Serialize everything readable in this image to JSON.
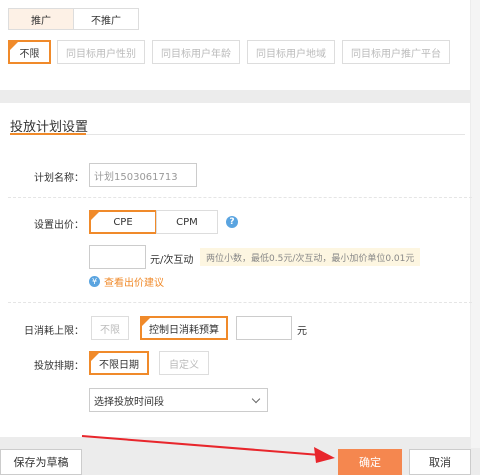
{
  "promo_tabs": [
    "推广",
    "不推广"
  ],
  "targeting": [
    "不限",
    "同目标用户性别",
    "同目标用户年龄",
    "同目标用户地域",
    "同目标用户推广平台"
  ],
  "section_title": "投放计划设置",
  "plan_name": {
    "label": "计划名称：",
    "value": "计划1503061713"
  },
  "bid": {
    "label": "设置出价：",
    "options": [
      "CPE",
      "CPM"
    ],
    "unit": "元/次互动",
    "hint": "两位小数，最低0.5元/次互动，最小加价单位0.01元",
    "link": "查看出价建议"
  },
  "daily_limit": {
    "label": "日消耗上限：",
    "options": [
      "不限",
      "控制日消耗预算"
    ],
    "unit": "元"
  },
  "schedule": {
    "label": "投放排期：",
    "options": [
      "不限日期",
      "自定义"
    ],
    "time_select": "选择投放时间段"
  },
  "footer": {
    "save_draft": "保存为草稿",
    "confirm": "确定",
    "cancel": "取消"
  },
  "colors": {
    "accent": "#f08a2a",
    "confirm": "#f5874f",
    "arrow": "#e8262c",
    "info": "#5aa4e0"
  },
  "icons": {
    "help": "?",
    "yen": "¥"
  }
}
